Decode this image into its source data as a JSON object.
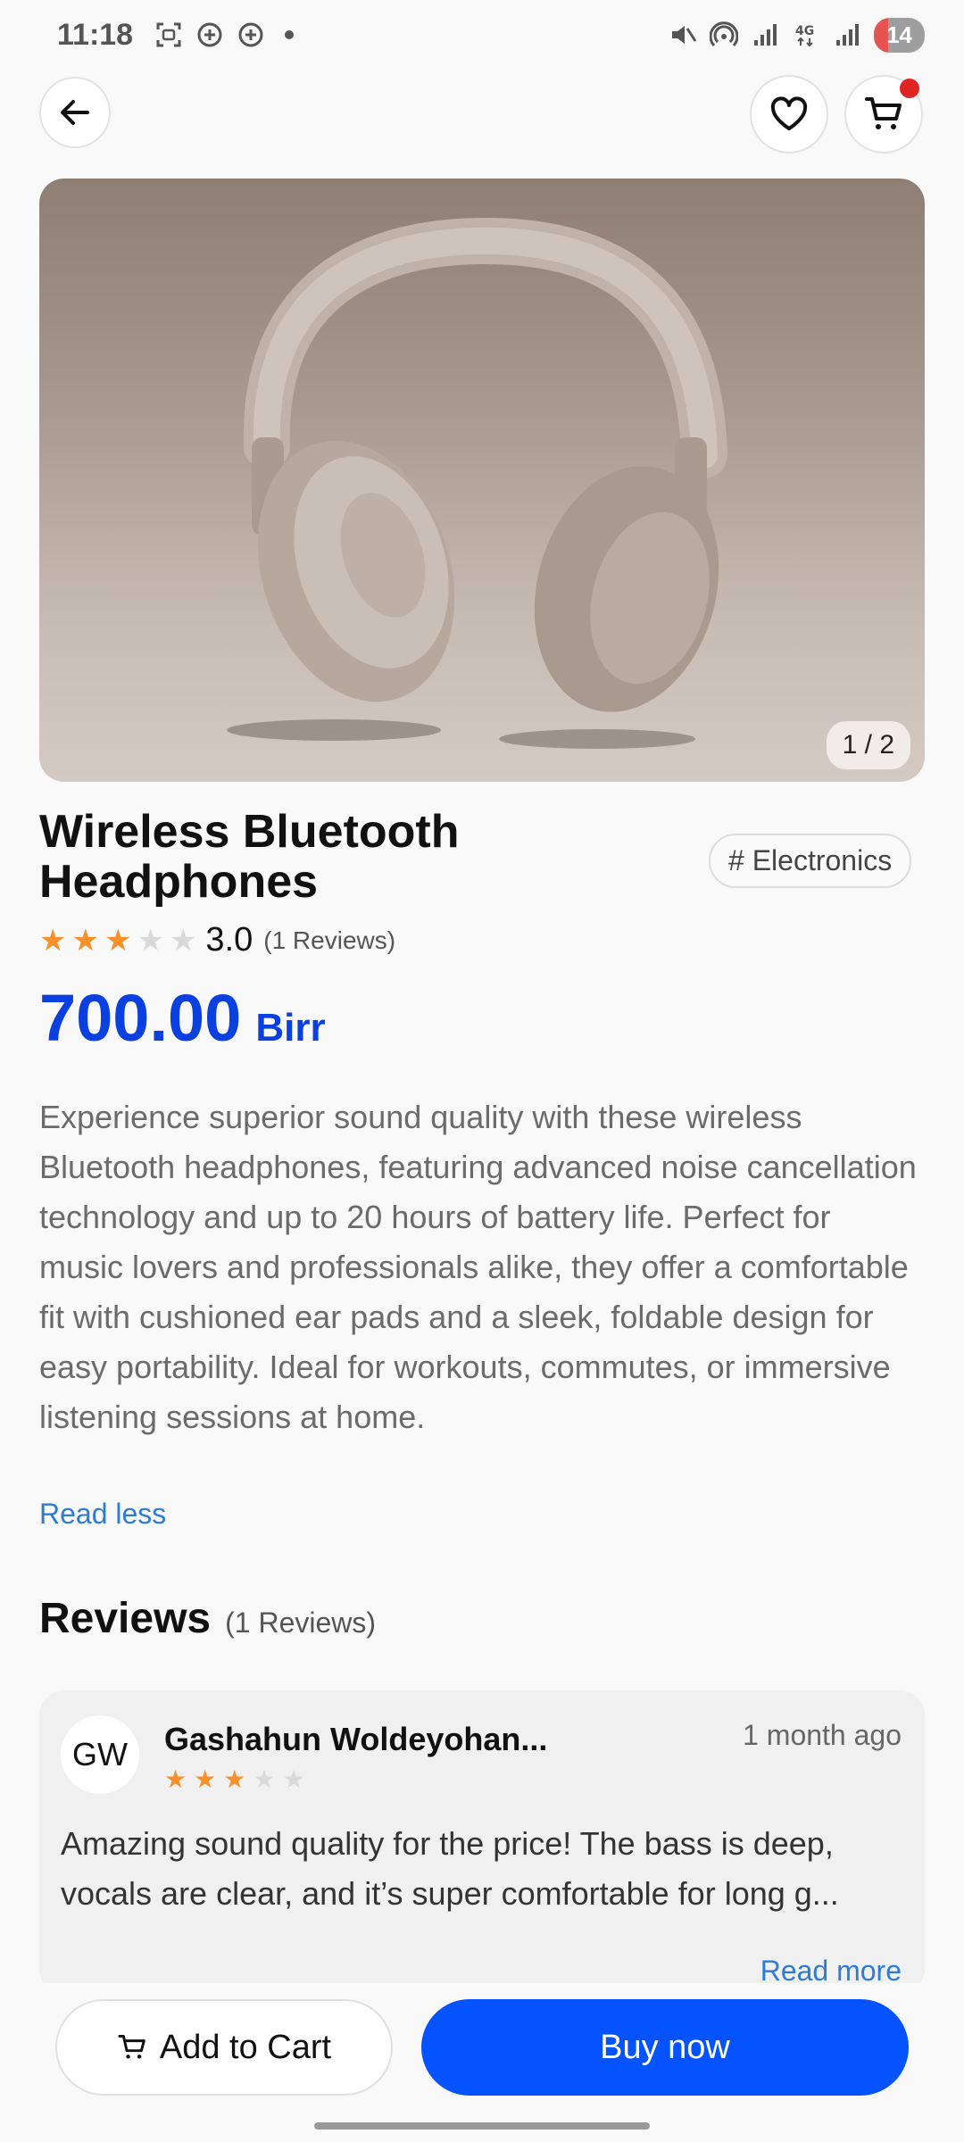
{
  "status_bar": {
    "time": "11:18",
    "battery": "14",
    "left_icons": [
      "screenshot-icon",
      "add-circle-icon",
      "add-circle-icon",
      "dot-icon"
    ],
    "right_icons": [
      "mute-icon",
      "hotspot-icon",
      "signal-icon",
      "4g-icon",
      "signal-icon"
    ]
  },
  "nav": {
    "back_icon": "arrow-left-icon",
    "favorite_icon": "heart-icon",
    "cart_icon": "cart-icon"
  },
  "product": {
    "image_counter": "1 / 2",
    "title": "Wireless Bluetooth Headphones",
    "category": "# Electronics",
    "rating": 3,
    "rating_value": "3.0",
    "rating_count": "(1 Reviews)",
    "price": "700.00",
    "currency": "Birr",
    "description": "Experience superior sound quality with these wireless Bluetooth headphones, featuring advanced noise cancellation technology and up to 20 hours of battery life. Perfect for music lovers and professionals alike, they offer a comfortable fit with cushioned ear pads and a sleek, foldable design for easy portability. Ideal for workouts, commutes, or immersive listening sessions at home.",
    "read_less": "Read less"
  },
  "reviews": {
    "title": "Reviews",
    "count": "(1 Reviews)",
    "items": [
      {
        "initials": "GW",
        "name": "Gashahun Woldeyohan...",
        "time": "1 month ago",
        "rating": 3,
        "text": "Amazing sound quality for the price! The bass is deep, vocals are clear, and it’s super comfortable for long g...",
        "read_more": "Read more"
      }
    ]
  },
  "actions": {
    "add_to_cart": "Add to Cart",
    "buy_now": "Buy now"
  },
  "colors": {
    "accent": "#0553ff",
    "price": "#0a3fe0",
    "star": "#f7902b",
    "link": "#2e7bd6"
  }
}
